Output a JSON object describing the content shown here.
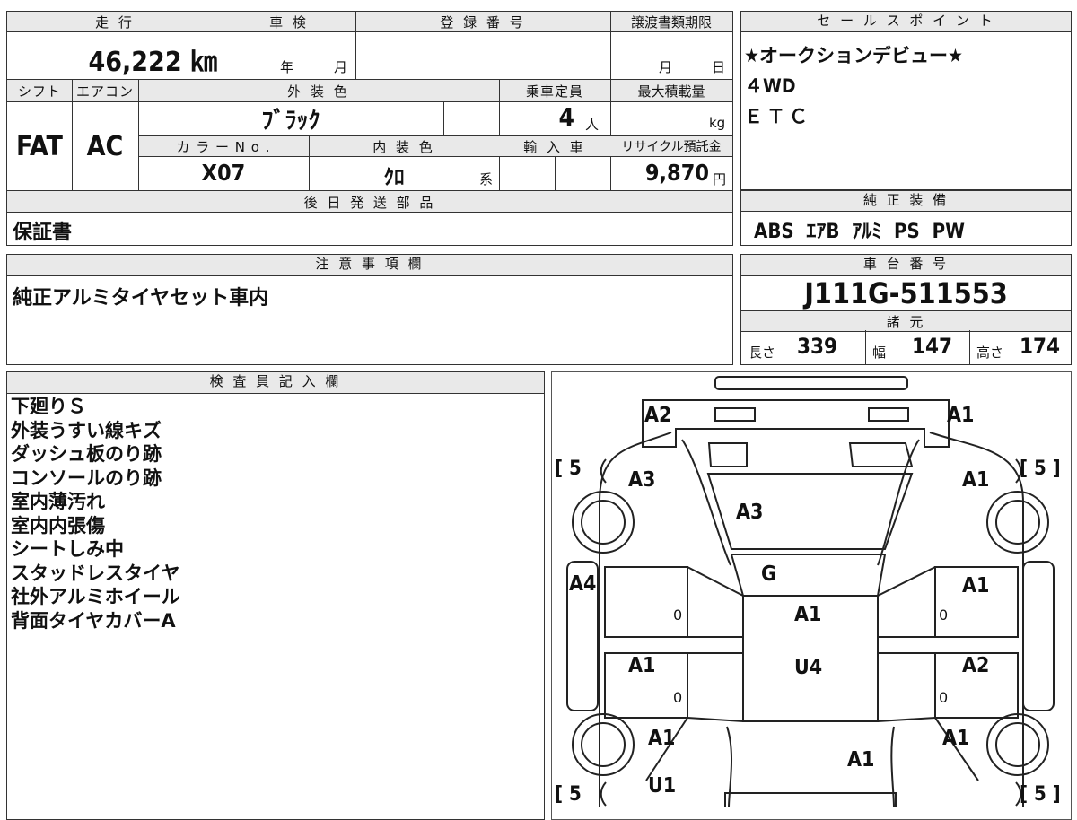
{
  "top": {
    "mileage_label": "走 行",
    "mileage_value": "46,222 ㎞",
    "shaken_label": "車 検",
    "shaken_year": "年",
    "shaken_month": "月",
    "reg_no_label": "登 録 番 号",
    "transfer_label": "譲渡書類期限",
    "transfer_month": "月",
    "transfer_day": "日",
    "shift_label": "シフト",
    "aircon_label": "エアコン",
    "exterior_color_label": "外 装 色",
    "capacity_label": "乗車定員",
    "max_load_label": "最大積載量",
    "shift_value": "FAT",
    "aircon_value": "AC",
    "exterior_color_value": "ﾌﾞﾗｯｸ",
    "capacity_value": "4",
    "capacity_unit": "人",
    "max_load_unit": "kg",
    "color_no_label": "カ ラ ー N o .",
    "interior_color_label": "内 装 色",
    "import_label": "輸 入 車",
    "recycle_label": "リサイクル預託金",
    "color_no_value": "X07",
    "interior_color_value": "ｸﾛ",
    "interior_suffix": "系",
    "recycle_value": "9,870",
    "recycle_unit": "円",
    "later_parts_label": "後 日 発 送 部 品",
    "later_parts_value": "保証書"
  },
  "sales": {
    "label": "セ ー ル ス ポ イ ン ト",
    "points": [
      "★オークションデビュー★",
      "４WD",
      "ＥＴＣ"
    ]
  },
  "equipment": {
    "label": "純 正 装 備",
    "value": "ABS  ｴｱB  ｱﾙﾐ  PS  PW"
  },
  "caution": {
    "label": "注 意 事 項 欄",
    "value": "純正アルミタイヤセット車内"
  },
  "chassis": {
    "label": "車 台 番 号",
    "value": "J111G-511553",
    "spec_label": "諸 元",
    "length_label": "長さ",
    "length_value": "339",
    "width_label": "幅",
    "width_value": "147",
    "height_label": "高さ",
    "height_value": "174"
  },
  "inspector": {
    "label": "検 査 員 記 入 欄",
    "notes": [
      "下廻りＳ",
      "外装うすい線キズ",
      "ダッシュ板のり跡",
      "コンソールのり跡",
      "室内薄汚れ",
      "室内内張傷",
      "シートしみ中",
      "スタッドレスタイヤ",
      "社外アルミホイール",
      "背面タイヤカバーA"
    ]
  },
  "diagram": {
    "marks": {
      "rear_left": "A2",
      "rear_right": "A1",
      "rear_left_quarter": "A3",
      "rear_right_quarter": "A1",
      "rear_glass": "A3",
      "roof_rear": "G",
      "roof": "A1",
      "floor": "U4",
      "left_rear_door": "A4",
      "right_rear_door": "A1",
      "left_front_door": "A1",
      "right_front_door": "A2",
      "left_front_fender": "A1",
      "right_front_fender": "A1",
      "hood": "A1",
      "left_under": "U1"
    },
    "tire_top_left": "5",
    "tire_top_right": "5",
    "tire_bottom_left": "5",
    "tire_bottom_right": "5",
    "door_zero": "0"
  }
}
